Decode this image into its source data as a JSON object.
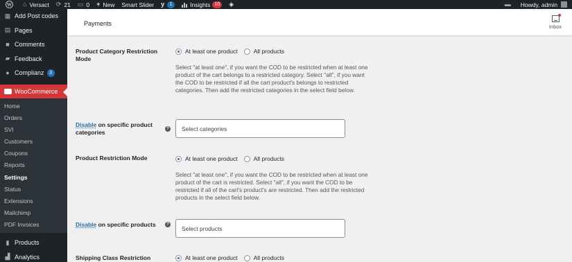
{
  "admin_bar": {
    "site_name": "Versact",
    "updates_count": "21",
    "comments_count": "0",
    "new_label": "New",
    "smart_slider": "Smart Slider",
    "yoast_count": "1",
    "insights_label": "Insights",
    "insights_count": "10",
    "howdy": "Howdy, admin"
  },
  "sidebar": {
    "items": [
      {
        "label": "Add Post codes",
        "icon": "pin-icon"
      },
      {
        "label": "Pages",
        "icon": "page-icon"
      },
      {
        "label": "Comments",
        "icon": "comment-icon"
      },
      {
        "label": "Feedback",
        "icon": "feedback-icon"
      },
      {
        "label": "Complianz",
        "icon": "complianz-icon",
        "badge": "3"
      }
    ],
    "current": {
      "label": "WooCommerce",
      "icon": "woocommerce-icon"
    },
    "submenu": [
      "Home",
      "Orders",
      "SVI",
      "Customers",
      "Coupons",
      "Reports",
      "Settings",
      "Status",
      "Extensions",
      "Mailchimp",
      "PDF Invoices"
    ],
    "active_submenu": "Settings",
    "after_items": [
      {
        "label": "Products",
        "icon": "products-icon"
      },
      {
        "label": "Analytics",
        "icon": "analytics-icon"
      }
    ]
  },
  "header": {
    "title": "Payments",
    "inbox_label": "Inbox"
  },
  "settings": {
    "category_mode": {
      "label": "Product Category Restriction Mode",
      "option_1": "At least one product",
      "option_2": "All products",
      "selected": "At least one product",
      "description": "Select \"at least one\", if you want the COD to be restricted when at least one product of the cart belongs to a restricted category. Select \"all\", if you want the COD to be restricted if all the cart product's belongs to restricted categories. Then add the restricted categories in the select field below."
    },
    "disable_categories": {
      "link": "Disable",
      "label_rest": " on specific product categories",
      "placeholder": "Select categories"
    },
    "product_mode": {
      "label": "Product Restriction Mode",
      "option_1": "At least one product",
      "option_2": "All products",
      "selected": "At least one product",
      "description": "Select \"at least one\", if you want the COD to be restricted when at least one product of the cart is restricted. Select \"all\", if you want the COD to be restricted if all of the cart's product's are restricted. Then add the restricted products in the select field below."
    },
    "disable_products": {
      "link": "Disable",
      "label_rest": " on specific products",
      "placeholder": "Select products"
    },
    "shipping_mode": {
      "label": "Shipping Class Restriction",
      "option_1": "At least one product",
      "option_2": "All products",
      "selected": "At least one product"
    }
  },
  "colors": {
    "admin_bar_bg": "#1d2327",
    "accent": "#2271b1",
    "woocommerce_current": "#d63638",
    "page_bg": "#f0f0f1"
  }
}
